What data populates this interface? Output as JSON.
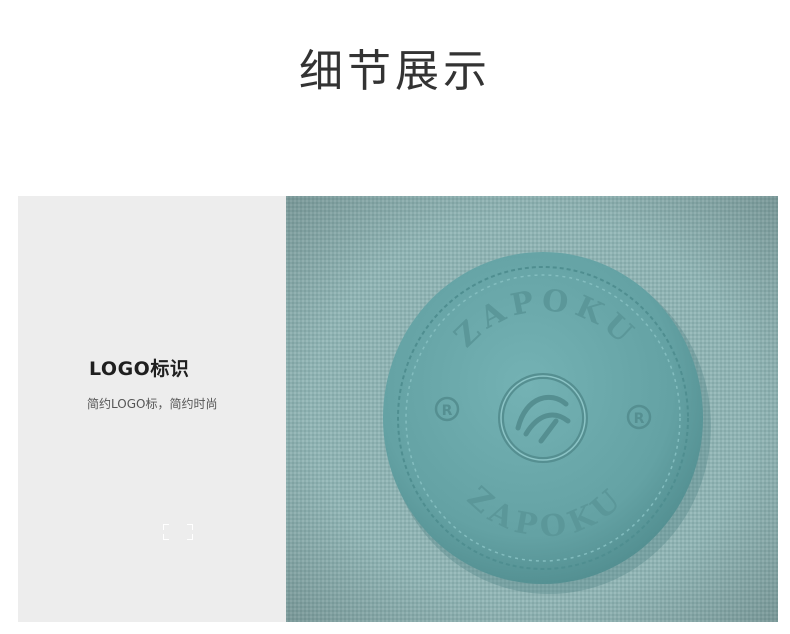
{
  "header": {
    "title": "细节展示"
  },
  "feature": {
    "heading": "LOGO标识",
    "description": "简约LOGO标，简约时尚"
  },
  "badge": {
    "brand_top": "ZAPOKU",
    "brand_bottom": "ZAPOKU",
    "registered_left": "R",
    "registered_right": "R"
  },
  "colors": {
    "fabric": "#8eb2b2",
    "badge": "#6aa9ab",
    "panel": "#ededed",
    "title": "#333333"
  },
  "icons": [
    "fullscreen-icon",
    "brand-emblem-icon",
    "registered-mark-icon"
  ]
}
